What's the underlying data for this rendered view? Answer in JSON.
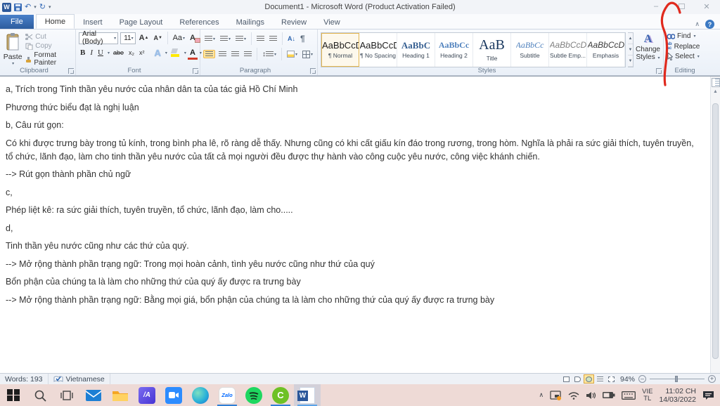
{
  "window": {
    "title": "Document1  -  Microsoft Word (Product Activation Failed)",
    "help": "?"
  },
  "ribbon": {
    "tabs": [
      {
        "label": "File"
      },
      {
        "label": "Home"
      },
      {
        "label": "Insert"
      },
      {
        "label": "Page Layout"
      },
      {
        "label": "References"
      },
      {
        "label": "Mailings"
      },
      {
        "label": "Review"
      },
      {
        "label": "View"
      }
    ],
    "clipboard": {
      "label": "Clipboard",
      "paste": "Paste",
      "cut": "Cut",
      "copy": "Copy",
      "format_painter": "Format Painter"
    },
    "font": {
      "label": "Font",
      "family": "Arial (Body)",
      "size": "11",
      "bold": "B",
      "italic": "I",
      "underline": "U",
      "strikethrough": "abe",
      "subscript": "x₂",
      "superscript": "x²",
      "change_case": "Aa",
      "grow": "A",
      "shrink": "A",
      "effects": "A",
      "font_color": "A",
      "clear": "A"
    },
    "paragraph": {
      "label": "Paragraph",
      "sort_a": "A",
      "sort_arrow": "↓",
      "pilcrow": "¶",
      "spacing": "↕"
    },
    "styles": {
      "label": "Styles",
      "change_styles": "Change Styles",
      "change_styles_icon": "A",
      "items": [
        {
          "preview": "AaBbCcD",
          "name": "¶ Normal"
        },
        {
          "preview": "AaBbCcD",
          "name": "¶ No Spacing"
        },
        {
          "preview": "AaBbC",
          "name": "Heading 1"
        },
        {
          "preview": "AaBbCc",
          "name": "Heading 2"
        },
        {
          "preview": "AaB",
          "name": "Title"
        },
        {
          "preview": "AaBbCc",
          "name": "Subtitle"
        },
        {
          "preview": "AaBbCcD",
          "name": "Subtle Emp..."
        },
        {
          "preview": "AaBbCcD",
          "name": "Emphasis"
        }
      ]
    },
    "editing": {
      "label": "Editing",
      "find": "Find",
      "replace": "Replace",
      "select": "Select"
    }
  },
  "document": {
    "paragraphs": [
      "a, Trích trong Tinh thần yêu nước của nhân dân ta của tác giả Hồ Chí Minh",
      "Phương thức biểu đạt là nghị luận",
      "b, Câu rút gọn:",
      "Có khi được trưng bày trong tủ kính, trong bình pha lê, rõ ràng dễ thấy. Nhưng cũng có khi cất giấu kín đáo trong rương, trong hòm. Nghĩa là phải ra sức giải thích, tuyên truyền, tổ chức, lãnh đạo, làm cho tinh thần yêu nước của tất cả mọi người đều được thự hành vào công cuộc yêu nước, công việc khánh chiến.",
      "--> Rút gọn thành phần chủ ngữ",
      "c,",
      "Phép liệt kê: ra sức giải thích, tuyên truyền, tổ chức, lãnh đạo, làm cho.....",
      "d,",
      "Tinh thần yêu nước cũng như các thứ của quý.",
      "--> Mở rộng thành phần trạng ngữ: Trong mọi hoàn cảnh, tình yêu nước cũng như thứ của quý",
      "Bổn phận của chúng ta là làm cho những thứ của quý ấy được ra trưng bày",
      "--> Mở rộng thành phần trạng ngữ: Bằng mọi giá, bổn phận của chúng ta là làm cho những thứ của quý ấy được ra trưng bày"
    ]
  },
  "status_bar": {
    "words": "Words: 193",
    "language": "Vietnamese",
    "zoom_level": "94%"
  },
  "taskbar": {
    "azota_text": "/A",
    "zalo_text": "Zalo",
    "coccoc_text": "C",
    "word_text": "W",
    "tray": {
      "lang_top": "VIE",
      "lang_bottom": "TL",
      "time": "11:02 CH",
      "date": "14/03/2022"
    }
  },
  "colors": {
    "accent_blue": "#2b579a",
    "taskbar_pink": "#eedad6",
    "annotation_red": "#e02a1e",
    "style_selected_border": "#e3b54e",
    "running_indicator": "#2f7fd6"
  }
}
